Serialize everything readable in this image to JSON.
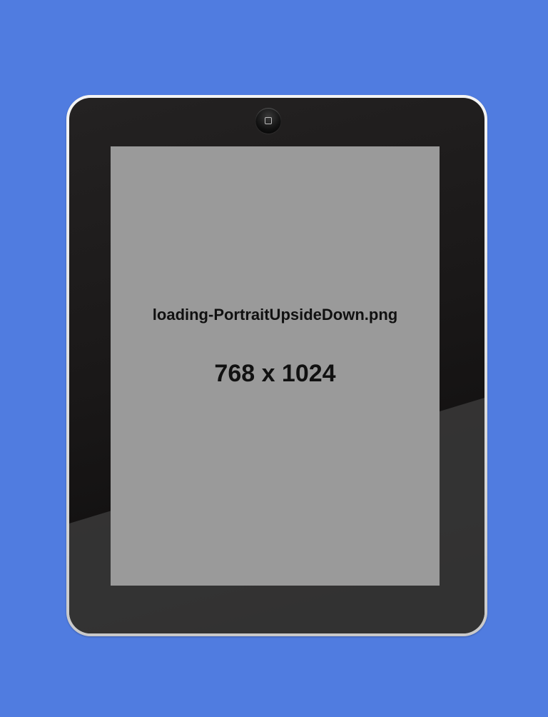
{
  "background_color": "#507ce0",
  "device": {
    "home_button_icon": "home-button-square-icon",
    "screen": {
      "filename": "loading-PortraitUpsideDown.png",
      "dimensions": "768 x 1024",
      "background_color": "#9a9a9a"
    }
  }
}
